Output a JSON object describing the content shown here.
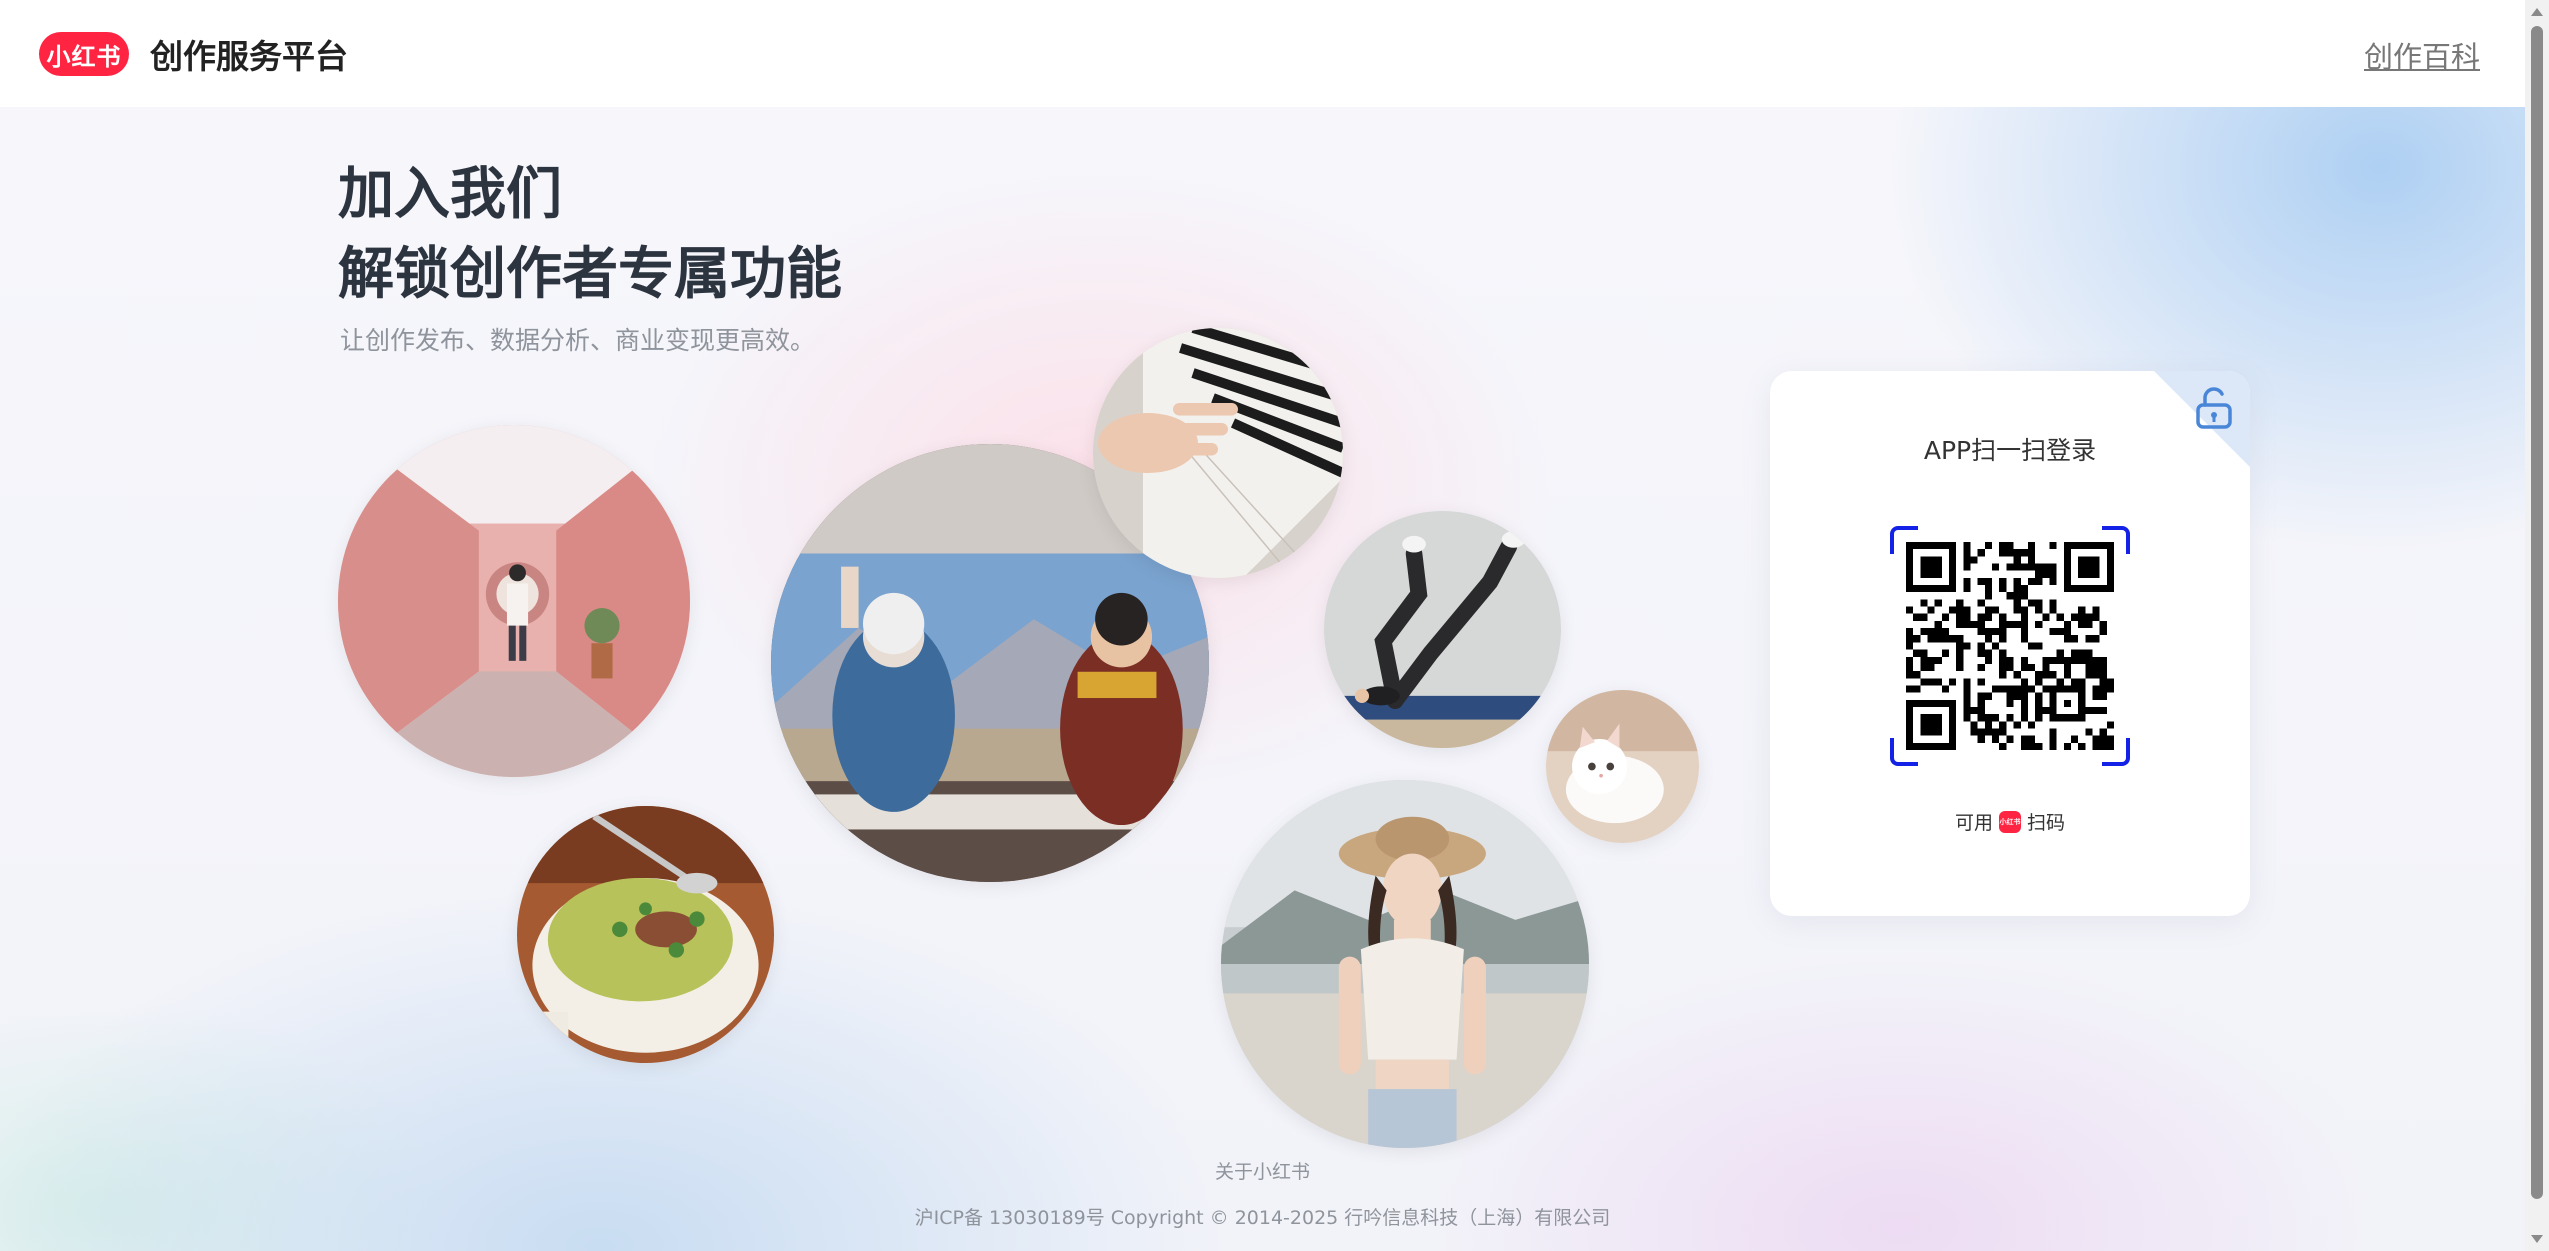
{
  "header": {
    "logo_text": "小红书",
    "title": "创作服务平台",
    "link_label": "创作百科"
  },
  "hero": {
    "line1": "加入我们",
    "line2": "解锁创作者专属功能",
    "subtitle": "让创作发布、数据分析、商业变现更高效。"
  },
  "photos": [
    {
      "name": "photo-pink-alley",
      "subject": "person walking down a pink alley"
    },
    {
      "name": "photo-soup-bowl",
      "subject": "bowl of pea soup"
    },
    {
      "name": "photo-road-trip",
      "subject": "friends cheering in a car trunk by mountains"
    },
    {
      "name": "photo-piano",
      "subject": "hand playing piano keys"
    },
    {
      "name": "photo-yoga",
      "subject": "person doing a leg stretch on a mat"
    },
    {
      "name": "photo-cat",
      "subject": "white kitten"
    },
    {
      "name": "photo-beach-woman",
      "subject": "woman in a hat on the beach"
    }
  ],
  "login": {
    "title": "APP扫一扫登录",
    "hint_prefix": "可用",
    "hint_logo": "小红书",
    "hint_suffix": "扫码"
  },
  "footer": {
    "about": "关于小红书",
    "copyright": "沪ICP备 13030189号 Copyright © 2014-2025 行吟信息科技（上海）有限公司"
  },
  "colors": {
    "brand_red": "#ff2442",
    "qr_frame_blue": "#1322e6",
    "heading": "#2c3440"
  }
}
